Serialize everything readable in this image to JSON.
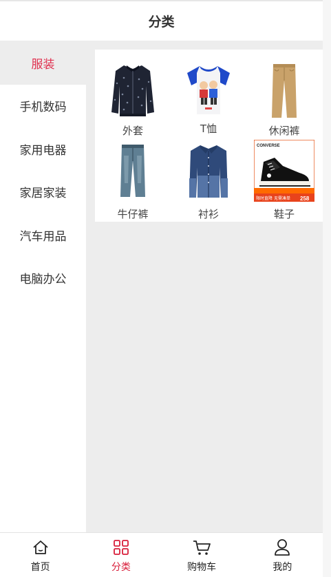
{
  "header": {
    "title": "分类"
  },
  "sidebar": {
    "items": [
      {
        "label": "服装",
        "active": true
      },
      {
        "label": "手机数码",
        "active": false
      },
      {
        "label": "家用电器",
        "active": false
      },
      {
        "label": "家居家装",
        "active": false
      },
      {
        "label": "汽车用品",
        "active": false
      },
      {
        "label": "电脑办公",
        "active": false
      }
    ]
  },
  "products": [
    {
      "label": "外套",
      "icon": "jacket-image"
    },
    {
      "label": "T恤",
      "icon": "tshirt-image"
    },
    {
      "label": "休闲裤",
      "icon": "pants-image"
    },
    {
      "label": "牛仔裤",
      "icon": "jeans-image"
    },
    {
      "label": "衬衫",
      "icon": "shirt-image"
    },
    {
      "label": "鞋子",
      "icon": "sneaker-image"
    }
  ],
  "shoe_banner": {
    "brand": "CONVERSE",
    "promo_left": "限时直降",
    "promo_mid": "无需凑单",
    "price": "258"
  },
  "tabbar": {
    "items": [
      {
        "label": "首页",
        "icon": "home-icon",
        "active": false
      },
      {
        "label": "分类",
        "icon": "category-icon",
        "active": true
      },
      {
        "label": "购物车",
        "icon": "cart-icon",
        "active": false
      },
      {
        "label": "我的",
        "icon": "user-icon",
        "active": false
      }
    ]
  },
  "colors": {
    "accent": "#e0304f",
    "tab_active": "#d81e3a",
    "content_bg": "#ededed"
  }
}
